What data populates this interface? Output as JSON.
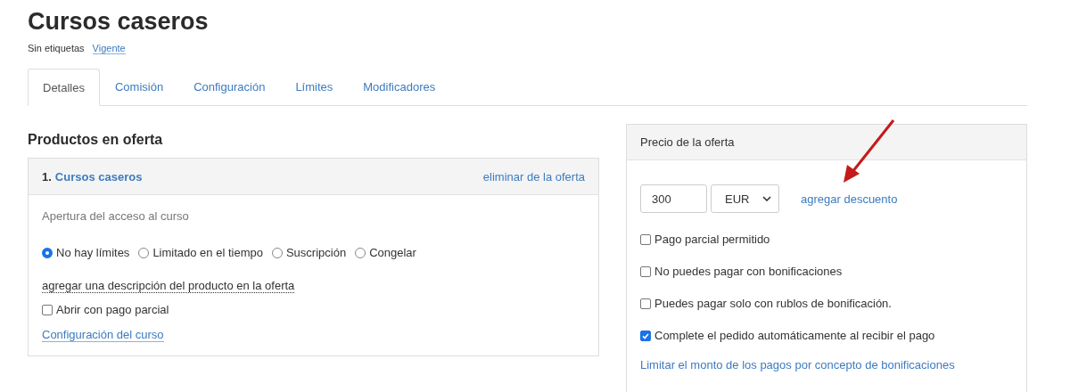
{
  "page": {
    "title": "Cursos caseros",
    "tags_label": "Sin etiquetas",
    "status_link": "Vigente"
  },
  "tabs": [
    {
      "label": "Detalles",
      "selected": true
    },
    {
      "label": "Comisión",
      "selected": false
    },
    {
      "label": "Configuración",
      "selected": false
    },
    {
      "label": "Límites",
      "selected": false
    },
    {
      "label": "Modificadores",
      "selected": false
    }
  ],
  "products": {
    "heading": "Productos en oferta",
    "items": [
      {
        "number": "1.",
        "name": "Cursos caseros",
        "remove_link": "eliminar de la oferta",
        "access_label": "Apertura del acceso al curso",
        "access_options": [
          {
            "label": "No hay límites",
            "selected": true
          },
          {
            "label": "Limitado en el tiempo",
            "selected": false
          },
          {
            "label": "Suscripción",
            "selected": false
          },
          {
            "label": "Congelar",
            "selected": false
          }
        ],
        "description_link": "agregar una descripción del producto en la oferta",
        "partial_payment": {
          "label": "Abrir con pago parcial",
          "checked": false
        },
        "settings_link": "Configuración del curso"
      }
    ]
  },
  "price": {
    "heading": "Precio de la oferta",
    "amount": "300",
    "currency": "EUR",
    "discount_link": "agregar descuento",
    "options": [
      {
        "label": "Pago parcial permitido",
        "checked": false
      },
      {
        "label": "No puedes pagar con bonificaciones",
        "checked": false
      },
      {
        "label": "Puedes pagar solo con rublos de bonificación.",
        "checked": false
      },
      {
        "label": "Complete el pedido automáticamente al recibir el pago",
        "checked": true
      }
    ],
    "bonus_limit_link": "Limitar el monto de los pagos por concepto de bonificaciones"
  }
}
